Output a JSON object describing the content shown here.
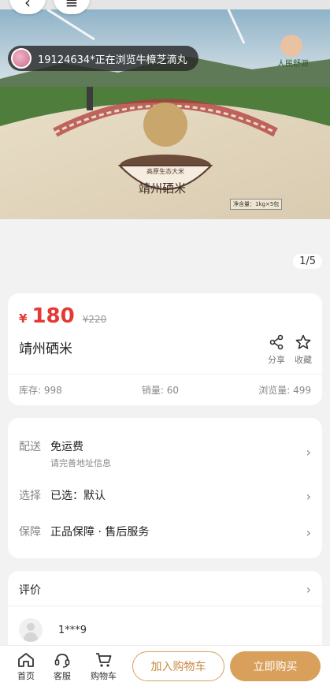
{
  "hero": {
    "viewer_toast": "19124634*正在浏览牛樟芝滴丸",
    "brand_text": "人民舒源",
    "package_label": "靖州硒米",
    "package_tag": "高原生态大米",
    "net_weight": "净含量：1kg×5包"
  },
  "gallery": {
    "pager": "1/5"
  },
  "product": {
    "currency": "¥",
    "price": "180",
    "original_price": "¥220",
    "title": "靖州硒米",
    "share_label": "分享",
    "favorite_label": "收藏",
    "stock": "库存: 998",
    "sales": "销量: 60",
    "views": "浏览量: 499"
  },
  "options": {
    "delivery": {
      "key": "配送",
      "value": "免运费",
      "sub": "请完善地址信息"
    },
    "select": {
      "key": "选择",
      "value": "已选：默认"
    },
    "guarantee": {
      "key": "保障",
      "value": "正品保障 · 售后服务"
    }
  },
  "reviews": {
    "title": "评价",
    "first_user": "1***9"
  },
  "bottom_bar": {
    "home": "首页",
    "service": "客服",
    "cart": "购物车",
    "add_to_cart": "加入购物车",
    "buy_now": "立即购买"
  },
  "colors": {
    "price_red": "#e53935",
    "accent_gold": "#d9a05b"
  }
}
